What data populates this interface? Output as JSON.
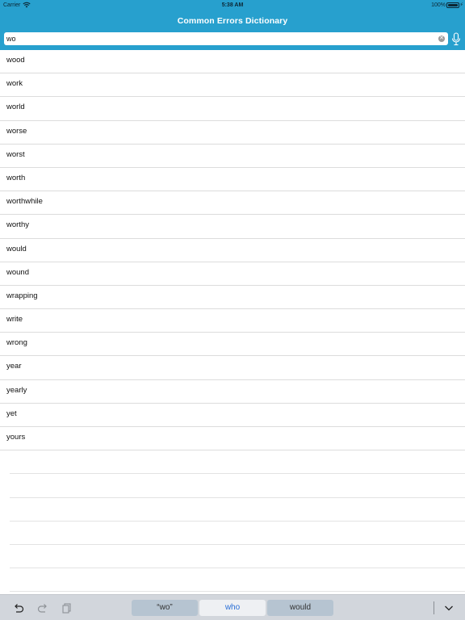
{
  "status_bar": {
    "carrier": "Carrier",
    "time": "5:38 AM",
    "battery_pct": "100%",
    "battery_level": 1.0
  },
  "nav": {
    "title": "Common Errors Dictionary"
  },
  "search": {
    "value": "wo",
    "accent_color": "#27a0ce"
  },
  "results": [
    "wood",
    "work",
    "world",
    "worse",
    "worst",
    "worth",
    "worthwhile",
    "worthy",
    "would",
    "wound",
    "wrapping",
    "write",
    "wrong",
    "year",
    "yearly",
    "yet",
    "yours"
  ],
  "keyboard_bar": {
    "suggestions": [
      "“wo”",
      "who",
      "would"
    ],
    "icons": [
      "undo-icon",
      "redo-icon",
      "paste-icon",
      "dismiss-keyboard-icon"
    ]
  }
}
